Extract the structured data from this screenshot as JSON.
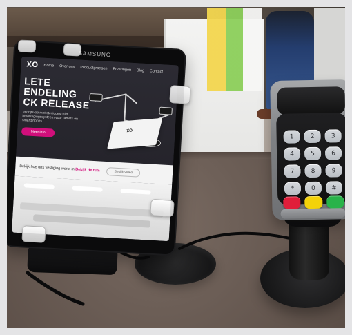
{
  "tablet": {
    "brand": "SAMSUNG",
    "site": {
      "logo": "XO",
      "nav": [
        "Home",
        "Over ons",
        "Productgroepen",
        "Ervaringen",
        "Blog",
        "Contact"
      ],
      "hero": {
        "lines": [
          "LETE",
          "ENDELING",
          "CK RELEASE"
        ],
        "subtitle": "bedrijfs-op met steviggeschikt bevestigingssysteem voor tablets en smartphones",
        "cta": "Meer info"
      },
      "band": {
        "prefix": "Bekijk hoe ons vestiging werkt in",
        "accent": "Bekijk de film",
        "button": "Bekijk video"
      }
    }
  },
  "terminal": {
    "keys": [
      "1",
      "2",
      "3",
      "4",
      "5",
      "6",
      "7",
      "8",
      "9",
      "*",
      "0",
      "#"
    ],
    "function_key_colors": {
      "red": "#e01e3a",
      "yellow": "#f3d20a",
      "green": "#29b34a"
    }
  },
  "icons": {
    "tablet-icon": "tablet",
    "payment-terminal-icon": "pin-terminal",
    "cable-icon": "cable"
  }
}
